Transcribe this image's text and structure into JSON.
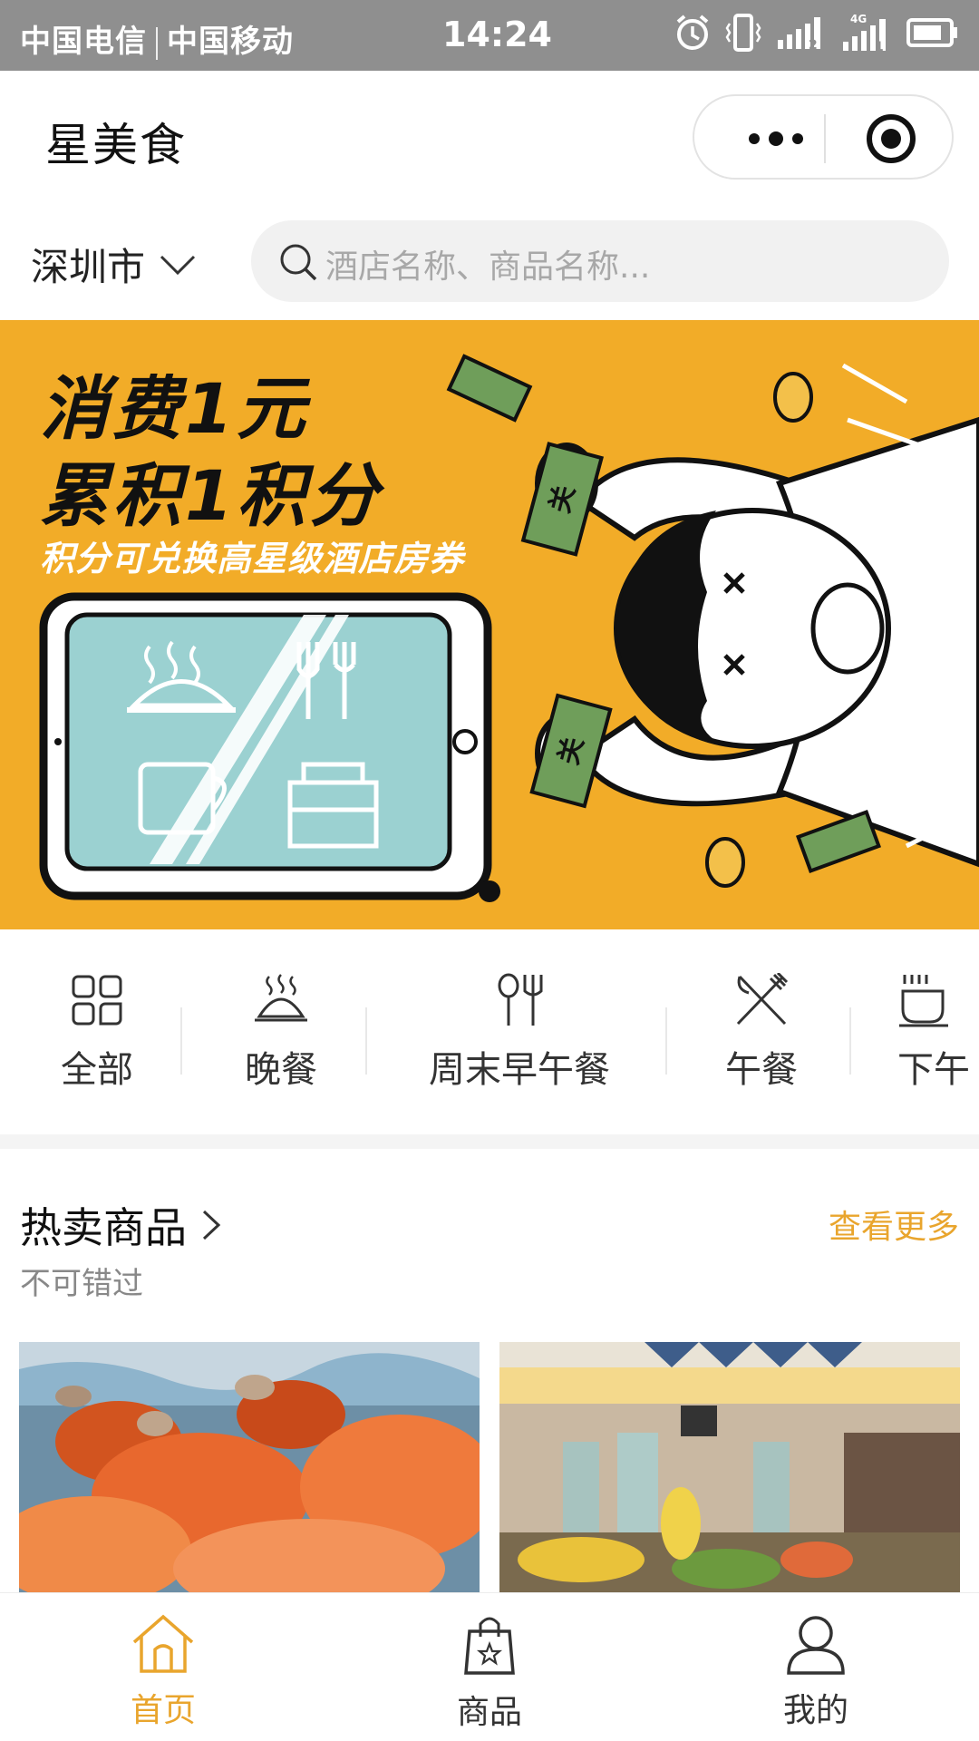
{
  "status_bar": {
    "carrier1": "中国电信",
    "carrier2": "中国移动",
    "time": "14:24",
    "network": "4G",
    "sim1": "2",
    "sim2": "1"
  },
  "header": {
    "title": "星美食",
    "more_icon": "more-dots-icon",
    "close_icon": "target-close-icon"
  },
  "search": {
    "city": "深圳市",
    "placeholder": "酒店名称、商品名称..."
  },
  "banner": {
    "line1": "消费1元",
    "line2": "累积1积分",
    "subline": "积分可兑换高星级酒店房券",
    "money_char": "关",
    "background": "#f2ac28"
  },
  "categories": [
    {
      "label": "全部",
      "icon": "grid-icon"
    },
    {
      "label": "晚餐",
      "icon": "cloche-icon"
    },
    {
      "label": "周末早午餐",
      "icon": "spoon-fork-icon"
    },
    {
      "label": "午餐",
      "icon": "crossed-utensils-icon"
    },
    {
      "label": "下午",
      "icon": "coffee-cup-icon"
    }
  ],
  "hot": {
    "title": "热卖商品",
    "subtitle": "不可错过",
    "more": "查看更多"
  },
  "tabs": [
    {
      "label": "首页",
      "icon": "home-icon",
      "active": true
    },
    {
      "label": "商品",
      "icon": "shopping-bag-icon",
      "active": false
    },
    {
      "label": "我的",
      "icon": "user-icon",
      "active": false
    }
  ],
  "colors": {
    "accent": "#e9a52d",
    "status_bar": "#8f8f8f"
  }
}
